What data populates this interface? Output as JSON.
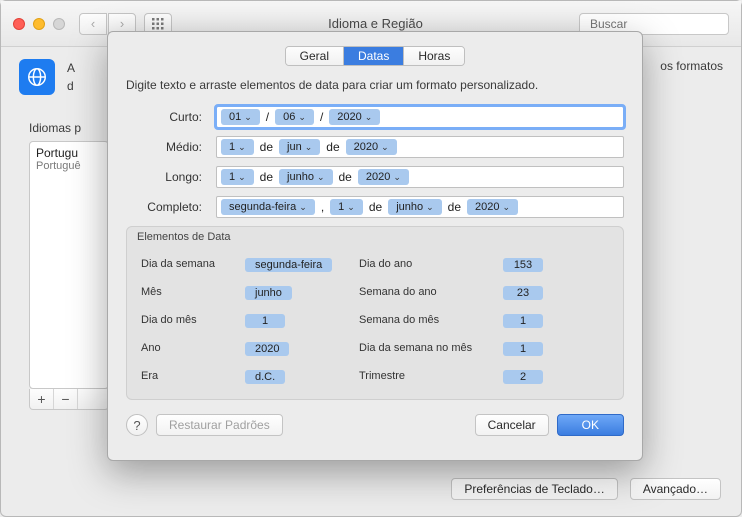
{
  "window": {
    "title": "Idioma e Região",
    "search_placeholder": "Buscar"
  },
  "background": {
    "header_prefix": "A",
    "header_suffix_fragment": "os formatos",
    "header_line2_fragment": "d",
    "sidebar_label": "Idiomas p",
    "lang_primary": "Portugu",
    "lang_secondary": "Portuguê",
    "footer_keyboard": "Preferências de Teclado…",
    "footer_advanced": "Avançado…"
  },
  "sheet": {
    "tabs": {
      "general": "Geral",
      "dates": "Datas",
      "times": "Horas"
    },
    "description": "Digite texto e arraste elementos de data para criar um formato personalizado.",
    "rows": {
      "short": {
        "label": "Curto:",
        "day": "01",
        "sep": "/",
        "month": "06",
        "year": "2020"
      },
      "medium": {
        "label": "Médio:",
        "day": "1",
        "de": "de",
        "month": "jun",
        "year": "2020"
      },
      "long": {
        "label": "Longo:",
        "day": "1",
        "de": "de",
        "month": "junho",
        "year": "2020"
      },
      "full": {
        "label": "Completo:",
        "weekday": "segunda-feira",
        "comma": ",",
        "day": "1",
        "de": "de",
        "month": "junho",
        "year": "2020"
      }
    },
    "elements": {
      "title": "Elementos de Data",
      "weekday_label": "Dia da semana",
      "weekday_val": "segunda-feira",
      "dayofyear_label": "Dia do ano",
      "dayofyear_val": "153",
      "month_label": "Mês",
      "month_val": "junho",
      "weekofyear_label": "Semana do ano",
      "weekofyear_val": "23",
      "dayofmonth_label": "Dia do mês",
      "dayofmonth_val": "1",
      "weekofmonth_label": "Semana do mês",
      "weekofmonth_val": "1",
      "year_label": "Ano",
      "year_val": "2020",
      "weekdayinmonth_label": "Dia da semana no mês",
      "weekdayinmonth_val": "1",
      "era_label": "Era",
      "era_val": "d.C.",
      "quarter_label": "Trimestre",
      "quarter_val": "2"
    },
    "footer": {
      "restore": "Restaurar Padrões",
      "cancel": "Cancelar",
      "ok": "OK"
    }
  }
}
